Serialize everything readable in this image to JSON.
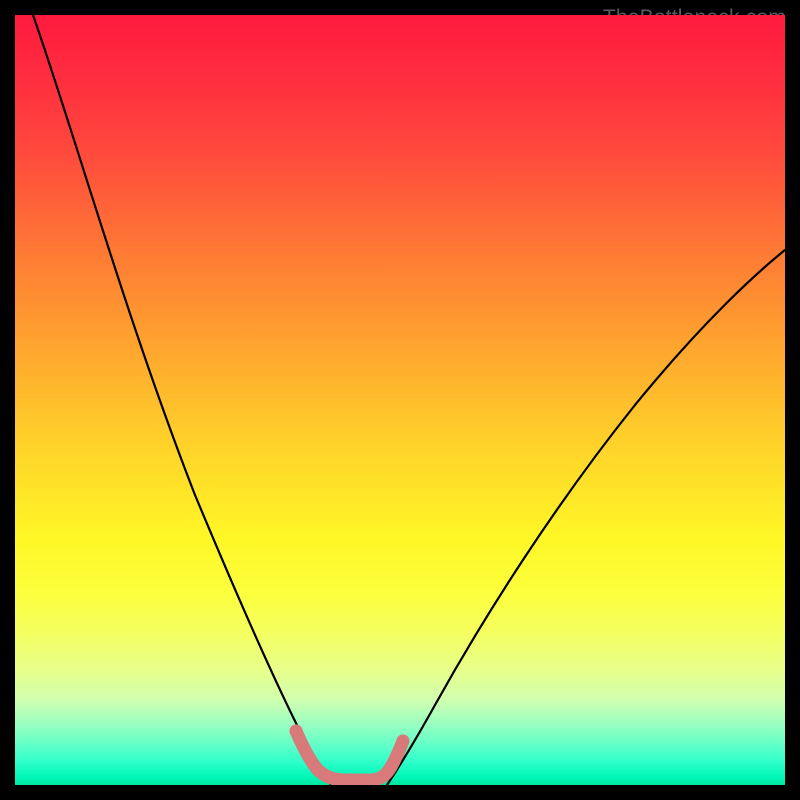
{
  "watermark": {
    "text": "TheBottleneck.com"
  },
  "chart_data": {
    "type": "line",
    "title": "",
    "xlabel": "",
    "ylabel": "",
    "xlim": [
      0,
      100
    ],
    "ylim": [
      0,
      100
    ],
    "series": [
      {
        "name": "left-descending-curve",
        "x": [
          2,
          5,
          10,
          15,
          20,
          25,
          28,
          31,
          34,
          36,
          38,
          40
        ],
        "y": [
          100,
          90,
          73,
          57,
          42,
          29,
          22,
          15,
          9,
          5,
          2,
          0
        ]
      },
      {
        "name": "right-ascending-curve",
        "x": [
          48,
          50,
          54,
          58,
          62,
          68,
          74,
          80,
          86,
          92,
          98,
          100
        ],
        "y": [
          0,
          2,
          8,
          14,
          21,
          30,
          39,
          47,
          54,
          61,
          67,
          69
        ]
      },
      {
        "name": "valley-highlight",
        "x": [
          36,
          37,
          38,
          40,
          42,
          44,
          46,
          48,
          49
        ],
        "y": [
          6,
          3,
          1.5,
          0.5,
          0.5,
          0.5,
          1,
          2.5,
          5
        ]
      }
    ],
    "colors": {
      "curve": "#000000",
      "valley": "#d97a7a"
    }
  }
}
